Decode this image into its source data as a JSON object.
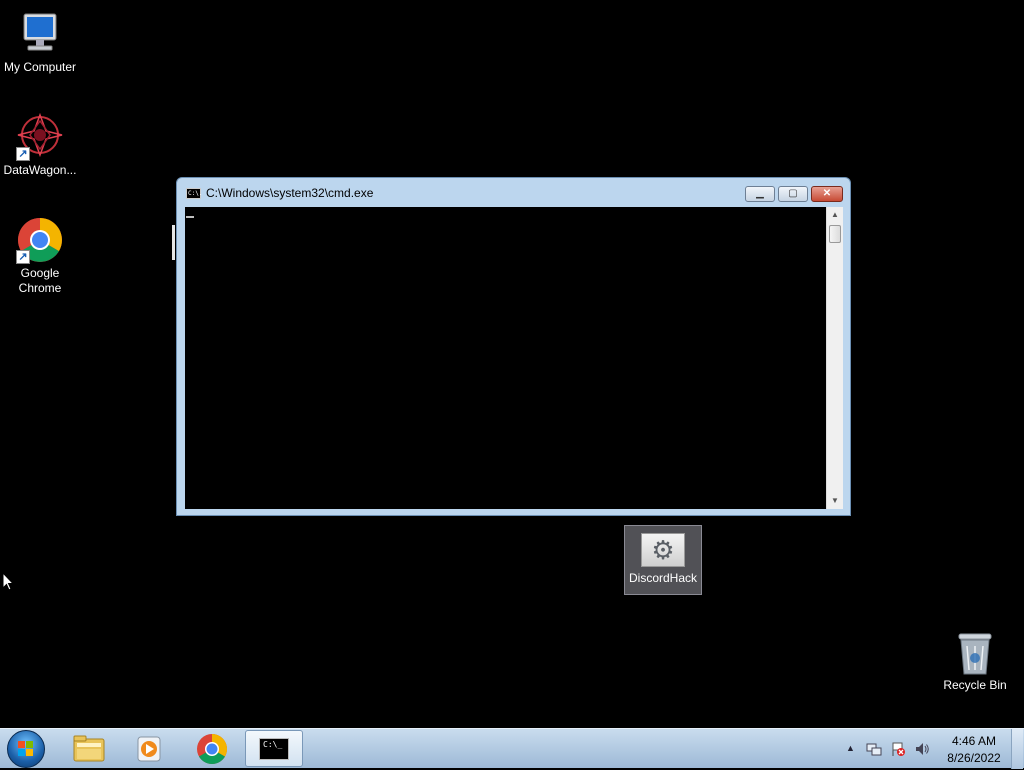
{
  "desktop": {
    "icons": [
      {
        "label": "My Computer",
        "icon": "computer-icon"
      },
      {
        "label": "DataWagon...",
        "icon": "datawagon-icon",
        "shortcut": true
      },
      {
        "label": "Google Chrome",
        "icon": "chrome-icon",
        "shortcut": true
      },
      {
        "label": "DiscordHack",
        "icon": "gear-settings-icon",
        "selected": true
      },
      {
        "label": "Recycle Bin",
        "icon": "recycle-bin-icon"
      }
    ]
  },
  "cmd_window": {
    "title": "C:\\Windows\\system32\\cmd.exe",
    "icon": "cmd-icon",
    "icon_text": "C:\\.",
    "minimize_label": "▁",
    "maximize_label": "▢",
    "close_label": "✕",
    "console_text": "",
    "scroll_up": "▲",
    "scroll_down": "▼"
  },
  "taskbar": {
    "start_icon": "windows-start-icon",
    "pinned": [
      {
        "name": "explorer",
        "icon": "folder-icon"
      },
      {
        "name": "media-player",
        "icon": "media-player-icon"
      },
      {
        "name": "chrome",
        "icon": "chrome-icon"
      },
      {
        "name": "cmd",
        "icon": "cmd-icon",
        "active": true,
        "icon_text": "C:\\_"
      }
    ],
    "tray": {
      "show_hidden": "▲",
      "network_icon": "network-icon",
      "action_center_icon": "action-center-flag-icon",
      "volume_icon": "volume-icon"
    },
    "clock": {
      "time": "4:46 AM",
      "date": "8/26/2022"
    }
  },
  "colors": {
    "desktop_bg": "#000000",
    "window_frame": "#bcd6ee",
    "close_button": "#c74a34",
    "taskbar": "#c9dcee"
  }
}
